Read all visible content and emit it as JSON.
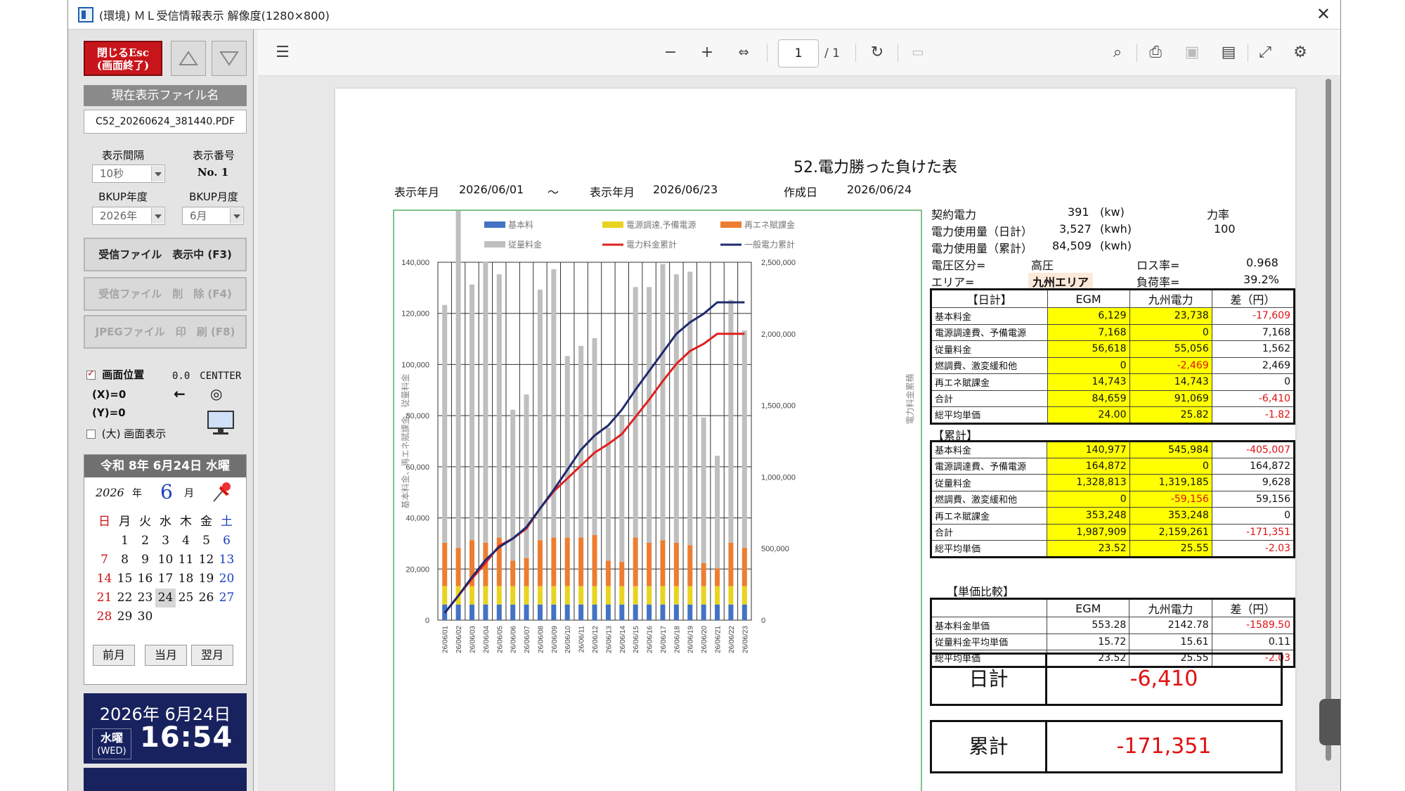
{
  "window": {
    "title": "(環境) ＭＬ受信情報表示 解像度(1280×800)",
    "close": "✕"
  },
  "left": {
    "close_btn": "閉じるEsc\n(画面終了)",
    "current_file_header": "現在表示ファイル名",
    "current_file": "C52_20260624_381440.PDF",
    "interval_label": "表示間隔",
    "interval_value": "10秒",
    "number_label": "表示番号",
    "number_value": "No. 1",
    "bkup_year_label": "BKUP年度",
    "bkup_year_value": "2026年",
    "bkup_month_label": "BKUP月度",
    "bkup_month_value": "6月",
    "btn_received": "受信ファイル　表示中 (F3)",
    "btn_delete": "受信ファイル　削　除 (F4)",
    "btn_print": "JPEGファイル　印　刷 (F8)",
    "pos_label": "画面位置",
    "pos_value": "0.0　CENTTER",
    "x_label": "(X)=0",
    "y_label": "(Y)=0",
    "arrow": "←",
    "target": "◎",
    "big_display": "(大) 画面表示"
  },
  "calendar": {
    "header": "令和 8年 6月24日 水曜",
    "year": "2026",
    "year_unit": "年",
    "month": "6",
    "month_unit": "月",
    "weekdays": [
      "日",
      "月",
      "火",
      "水",
      "木",
      "金",
      "土"
    ],
    "weeks": [
      [
        "",
        "1",
        "2",
        "3",
        "4",
        "5",
        "6"
      ],
      [
        "7",
        "8",
        "9",
        "10",
        "11",
        "12",
        "13"
      ],
      [
        "14",
        "15",
        "16",
        "17",
        "18",
        "19",
        "20"
      ],
      [
        "21",
        "22",
        "23",
        "24",
        "25",
        "26",
        "27"
      ],
      [
        "28",
        "29",
        "30",
        "",
        "",
        "",
        ""
      ]
    ],
    "today": "24",
    "prev": "前月",
    "current": "当月",
    "next": "翌月"
  },
  "clock": {
    "date": "2026年 6月24日",
    "dow": "水曜",
    "dow_en": "(WED)",
    "time": "16:54"
  },
  "viewer": {
    "page": "1",
    "page_total": "/ 1"
  },
  "doc": {
    "title": "52.電力勝った負けた表",
    "from_label": "表示年月",
    "from": "2026/06/01",
    "tilde": "〜",
    "to_label": "表示年月",
    "to": "2026/06/23",
    "made_label": "作成日",
    "made": "2026/06/24"
  },
  "chart_data": {
    "type": "bar",
    "categories": [
      "26/06/01",
      "26/06/02",
      "26/06/03",
      "26/06/04",
      "26/06/05",
      "26/06/06",
      "26/06/07",
      "26/06/08",
      "26/06/09",
      "26/06/10",
      "26/06/11",
      "26/06/12",
      "26/06/13",
      "26/06/14",
      "26/06/15",
      "26/06/16",
      "26/06/17",
      "26/06/18",
      "26/06/19",
      "26/06/20",
      "26/06/21",
      "26/06/22",
      "26/06/23"
    ],
    "series": [
      {
        "name": "基本料",
        "values": [
          6129,
          6129,
          6129,
          6129,
          6129,
          6129,
          6129,
          6129,
          6129,
          6129,
          6129,
          6129,
          6129,
          6129,
          6129,
          6129,
          6129,
          6129,
          6129,
          6129,
          6129,
          6129,
          6129
        ]
      },
      {
        "name": "電源調達,予備電源",
        "values": [
          7168,
          7168,
          7168,
          7168,
          7168,
          7168,
          7168,
          7168,
          7168,
          7168,
          7168,
          7168,
          7168,
          7168,
          7168,
          7168,
          7168,
          7168,
          7168,
          7168,
          7168,
          7168,
          7168
        ]
      },
      {
        "name": "再エネ賦課金",
        "values": [
          17000,
          15000,
          18000,
          17000,
          19000,
          10000,
          11000,
          18000,
          19000,
          19000,
          19000,
          20000,
          10000,
          9500,
          19000,
          17000,
          18000,
          17000,
          16000,
          9000,
          7000,
          17000,
          15000
        ]
      },
      {
        "name": "従量料金",
        "values": [
          93000,
          132000,
          100000,
          110000,
          103000,
          59000,
          64000,
          98000,
          105000,
          71000,
          75000,
          77000,
          52000,
          57000,
          98000,
          100000,
          108000,
          105000,
          107000,
          57000,
          44000,
          95000,
          85000
        ]
      },
      {
        "name": "電力料金累計",
        "type": "line",
        "axis": "right",
        "values": [
          50000,
          170000,
          290000,
          400000,
          520000,
          570000,
          640000,
          780000,
          900000,
          990000,
          1080000,
          1170000,
          1230000,
          1300000,
          1420000,
          1540000,
          1670000,
          1790000,
          1880000,
          1930000,
          2000000,
          2000000,
          2000000
        ]
      },
      {
        "name": "一般電力累計",
        "type": "line",
        "axis": "right",
        "values": [
          50000,
          170000,
          300000,
          420000,
          510000,
          570000,
          650000,
          780000,
          910000,
          1050000,
          1190000,
          1290000,
          1360000,
          1470000,
          1610000,
          1740000,
          1870000,
          2000000,
          2080000,
          2140000,
          2220000,
          2220000,
          2220000
        ]
      }
    ],
    "ylabel": "基本料金、再エネ賦課金、従量料金",
    "ylabel_right": "電力料金累積",
    "ylim": [
      0,
      140000
    ],
    "yticks": [
      "0",
      "20,000",
      "40,000",
      "60,000",
      "80,000",
      "100,000",
      "120,000",
      "140,000"
    ],
    "ylim_right": [
      0,
      2500000
    ],
    "yticks_right": [
      "0",
      "500,000",
      "1,000,000",
      "1,500,000",
      "2,000,000",
      "2,500,000"
    ],
    "colors": {
      "base": "#4472c4",
      "supply": "#e8d420",
      "renew": "#ed7d31",
      "usage": "#bfbfbf",
      "cum_red": "#e02020",
      "cum_navy": "#1f2a6e"
    },
    "legend_placement": "top",
    "grid": true
  },
  "info": {
    "contract_label": "契約電力",
    "contract_val": "391",
    "contract_unit": "(kw)",
    "pf_label": "力率",
    "pf_val": "100",
    "day_use_label": "電力使用量（日計）",
    "day_use_val": "3,527",
    "day_use_unit": "(kwh)",
    "cum_use_label": "電力使用量（累計）",
    "cum_use_val": "84,509",
    "cum_use_unit": "(kwh)",
    "volt_label": "電圧区分=",
    "volt_val": "高圧",
    "loss_label": "ロス率=",
    "loss_val": "0.968",
    "area_label": "エリア=",
    "area_val": "九州エリア",
    "load_label": "負荷率=",
    "load_val": "39.2%"
  },
  "daily": {
    "head": [
      "【日計】",
      "EGM",
      "九州電力",
      "差（円）"
    ],
    "rows": [
      [
        "基本料金",
        "6,129",
        "23,738",
        "-17,609"
      ],
      [
        "電源調達費、予備電源",
        "7,168",
        "0",
        "7,168"
      ],
      [
        "従量料金",
        "56,618",
        "55,056",
        "1,562"
      ],
      [
        "燃調費、激変緩和他",
        "0",
        "-2,469",
        "2,469"
      ],
      [
        "再エネ賦課金",
        "14,743",
        "14,743",
        "0"
      ],
      [
        "合計",
        "84,659",
        "91,069",
        "-6,410"
      ],
      [
        "総平均単価",
        "24.00",
        "25.82",
        "-1.82"
      ]
    ]
  },
  "cumulative": {
    "label": "【累計】",
    "rows": [
      [
        "基本料金",
        "140,977",
        "545,984",
        "-405,007"
      ],
      [
        "電源調達費、予備電源",
        "164,872",
        "0",
        "164,872"
      ],
      [
        "従量料金",
        "1,328,813",
        "1,319,185",
        "9,628"
      ],
      [
        "燃調費、激変緩和他",
        "0",
        "-59,156",
        "59,156"
      ],
      [
        "再エネ賦課金",
        "353,248",
        "353,248",
        "0"
      ],
      [
        "合計",
        "1,987,909",
        "2,159,261",
        "-171,351"
      ],
      [
        "総平均単価",
        "23.52",
        "25.55",
        "-2.03"
      ]
    ]
  },
  "unit_compare": {
    "label": "【単価比較】",
    "head": [
      "",
      "EGM",
      "九州電力",
      "差（円）"
    ],
    "rows": [
      [
        "基本料金単価",
        "553.28",
        "2142.78",
        "-1589.50"
      ],
      [
        "従量料金平均単価",
        "15.72",
        "15.61",
        "0.11"
      ],
      [
        "総平均単価",
        "23.52",
        "25.55",
        "-2.03"
      ]
    ]
  },
  "summary": {
    "day_label": "日計",
    "day_val": "-6,410",
    "cum_label": "累計",
    "cum_val": "-171,351"
  }
}
